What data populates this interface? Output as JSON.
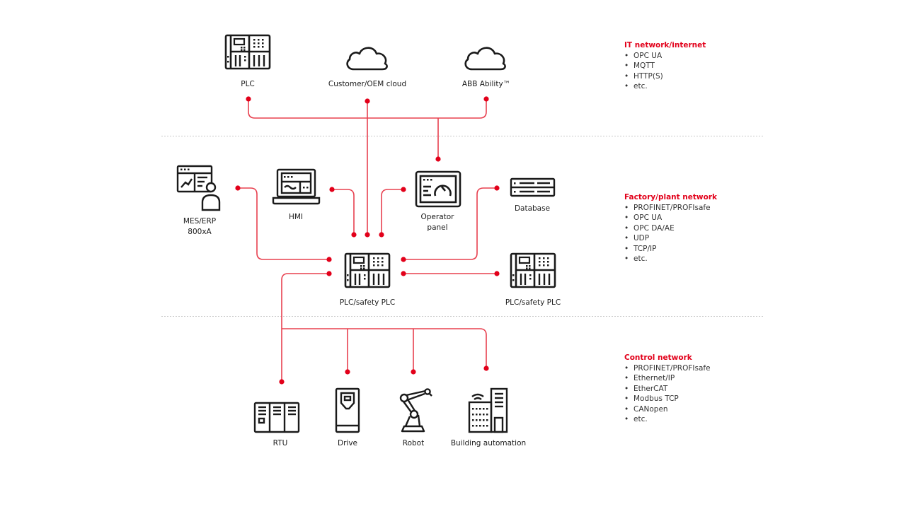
{
  "colors": {
    "accent": "#e2001a",
    "line": "#e8404f",
    "icon": "#1a1a1a",
    "separator": "#c8c8c8"
  },
  "zones": [
    {
      "title": "IT network/internet",
      "protocols": [
        "OPC UA",
        "MQTT",
        "HTTP(S)",
        "etc."
      ]
    },
    {
      "title": "Factory/plant network",
      "protocols": [
        "PROFINET/PROFIsafe",
        "OPC UA",
        "OPC DA/AE",
        "UDP",
        "TCP/IP",
        "etc."
      ]
    },
    {
      "title": "Control network",
      "protocols": [
        "PROFINET/PROFIsafe",
        "Ethernet/IP",
        "EtherCAT",
        "Modbus TCP",
        "CANopen",
        "etc."
      ]
    }
  ],
  "nodes": {
    "plc_top": {
      "label": "PLC",
      "icon": "plc-icon"
    },
    "customer_cloud": {
      "label": "Customer/OEM cloud",
      "icon": "cloud-icon"
    },
    "abb_ability": {
      "label": "ABB Ability™",
      "icon": "cloud-icon"
    },
    "mes_erp": {
      "label_line1": "MES/ERP",
      "label_line2": "800xA",
      "icon": "mes-user-icon"
    },
    "hmi": {
      "label": "HMI",
      "icon": "laptop-icon"
    },
    "operator_panel": {
      "label_line1": "Operator",
      "label_line2": "panel",
      "icon": "gauge-panel-icon"
    },
    "database": {
      "label": "Database",
      "icon": "server-icon"
    },
    "plc_safety_main": {
      "label": "PLC/safety PLC",
      "icon": "plc-icon"
    },
    "plc_safety_peer": {
      "label": "PLC/safety PLC",
      "icon": "plc-icon"
    },
    "rtu": {
      "label": "RTU",
      "icon": "rtu-cabinet-icon"
    },
    "drive": {
      "label": "Drive",
      "icon": "drive-icon"
    },
    "robot": {
      "label": "Robot",
      "icon": "robot-arm-icon"
    },
    "building": {
      "label": "Building automation",
      "icon": "building-icon"
    }
  }
}
